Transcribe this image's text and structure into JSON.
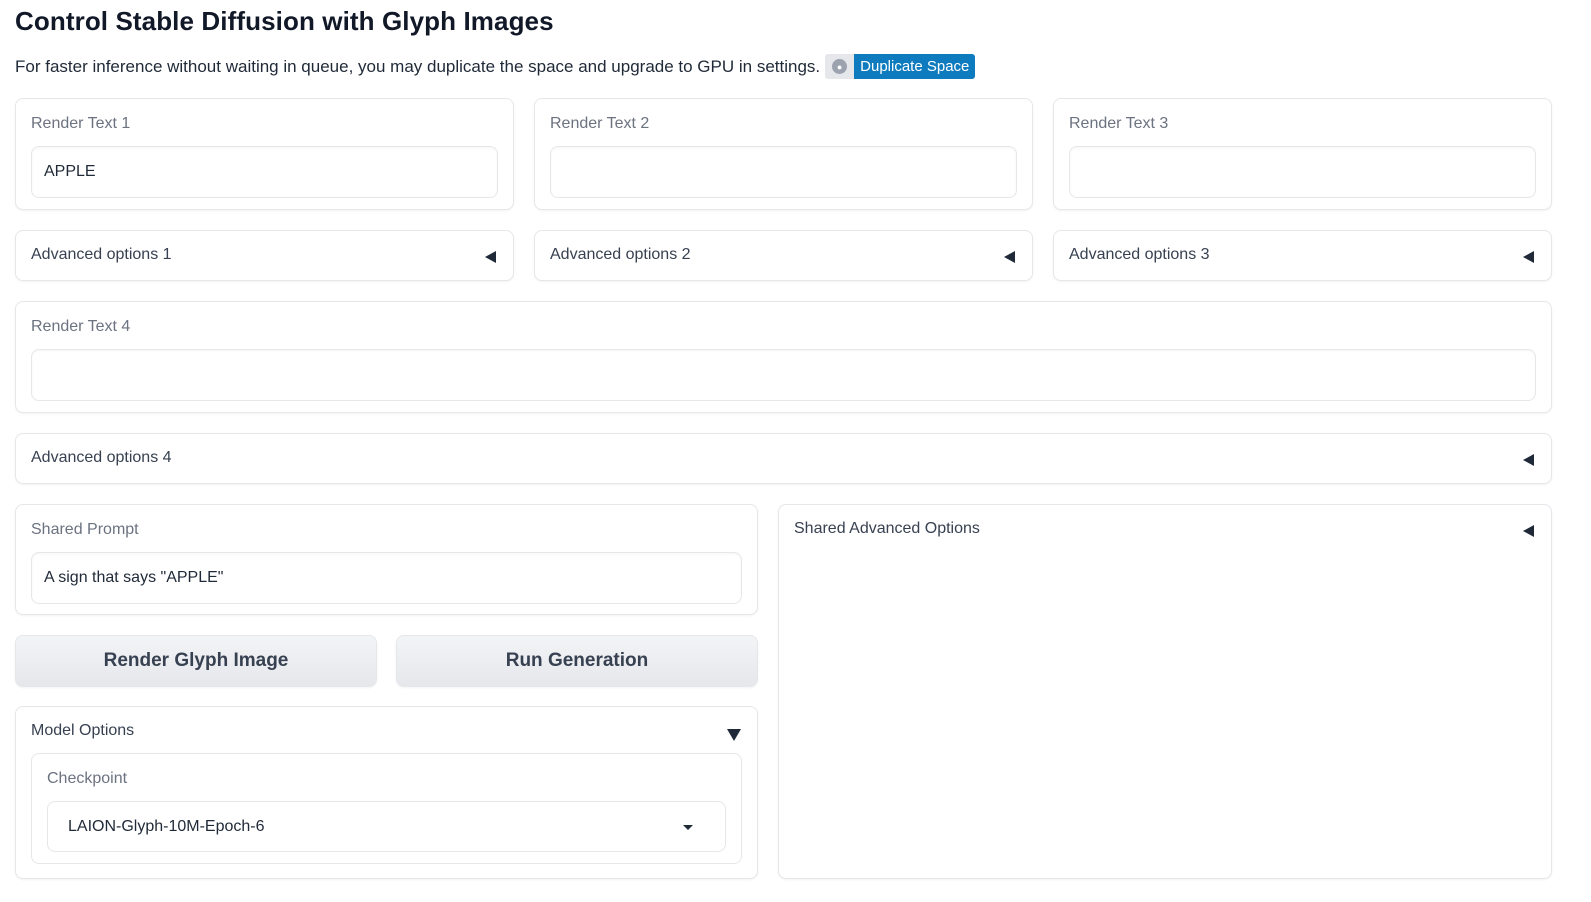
{
  "header": {
    "title": "Control Stable Diffusion with Glyph Images",
    "notice": "For faster inference without waiting in queue, you may duplicate the space and upgrade to GPU in settings.",
    "duplicate_label": "Duplicate Space",
    "duplicate_color": "#0e7bbf"
  },
  "render_texts": [
    {
      "label": "Render Text 1",
      "value": "APPLE"
    },
    {
      "label": "Render Text 2",
      "value": ""
    },
    {
      "label": "Render Text 3",
      "value": ""
    },
    {
      "label": "Render Text 4",
      "value": ""
    }
  ],
  "advanced": [
    {
      "label": "Advanced options 1"
    },
    {
      "label": "Advanced options 2"
    },
    {
      "label": "Advanced options 3"
    },
    {
      "label": "Advanced options 4"
    }
  ],
  "prompt": {
    "label": "Shared Prompt",
    "value": "A sign that says \"APPLE\""
  },
  "buttons": {
    "render": "Render Glyph Image",
    "run": "Run Generation"
  },
  "model_options": {
    "label": "Model Options",
    "checkpoint_label": "Checkpoint",
    "checkpoint_value": "LAION-Glyph-10M-Epoch-6"
  },
  "shared_advanced": {
    "label": "Shared Advanced Options"
  }
}
